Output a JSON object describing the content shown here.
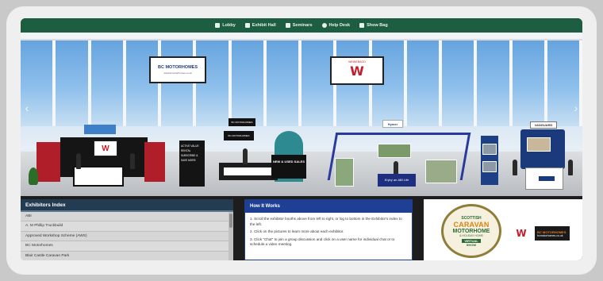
{
  "nav": {
    "items": [
      {
        "label": "Lobby",
        "icon": "building-icon"
      },
      {
        "label": "Exhibit Hall",
        "icon": "door-icon"
      },
      {
        "label": "Seminars",
        "icon": "presentation-icon"
      },
      {
        "label": "Help Desk",
        "icon": "info-icon"
      },
      {
        "label": "Show Bag",
        "icon": "bag-icon"
      }
    ]
  },
  "hall": {
    "left_arrow": "‹",
    "right_arrow": "›",
    "hanging_signs": [
      {
        "title": "BC MOTORHOMES",
        "subtitle": "www.bcmotorhomes.co.uk"
      },
      {
        "title": "W",
        "subtitle": "WINNEBAGO"
      }
    ],
    "booths": {
      "winnebago": {
        "mark": "W"
      },
      "bc": {
        "tower_text": [
          "ACTIVE VALUE",
          "RENTAL",
          "SUBSCRIBE &",
          "SAVE MORE"
        ],
        "screen_text": "NEW & USED SALES",
        "hang_text": "BC MOTORHOMES"
      },
      "hymer": {
        "logo": "Hymer",
        "desk": "Enjoy an ABI Life"
      },
      "caravans": {
        "logo": "VANGUARD"
      }
    }
  },
  "exhibitors": {
    "title": "Exhibitors Index",
    "items": [
      "ABI",
      "A. M Phillip Truckbuild",
      "Approved Workshop Scheme (AWS)",
      "BC Motorhomes",
      "Blair Castle Caravan Park"
    ]
  },
  "how": {
    "title": "How It Works",
    "steps": [
      "1. Scroll the exhibitor booths above from left to right, or log to bottom in the Exhibitor's index to the left.",
      "2. Click on the pictures to learn more about each exhibitor.",
      "3. Click \"Chat\" to join a group discussion and click on a user name for individual chat or to schedule a video meeting."
    ]
  },
  "sponsor": {
    "badge_lines": [
      "SCOTTISH",
      "CARAVAN",
      "MOTORHOME",
      "& HOLIDAY HOME",
      "VIRTUAL",
      "SHOW"
    ],
    "w_mark": "W",
    "bc_title": "BC MOTORHOMES",
    "bc_sub": "bcmotorhomes.co.uk"
  }
}
